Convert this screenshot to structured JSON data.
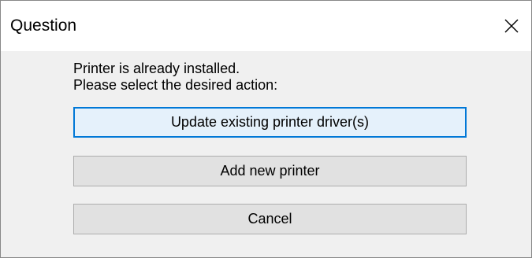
{
  "window": {
    "title": "Question"
  },
  "message": {
    "line1": "Printer is already installed.",
    "line2": "Please select the desired action:"
  },
  "buttons": {
    "update": "Update existing printer driver(s)",
    "add": "Add new printer",
    "cancel": "Cancel"
  },
  "icons": {
    "close": "close-icon"
  },
  "colors": {
    "client_background": "#f0f0f0",
    "default_button_border": "#0078d7",
    "default_button_background": "#e5f1fb",
    "button_background": "#e1e1e1"
  }
}
